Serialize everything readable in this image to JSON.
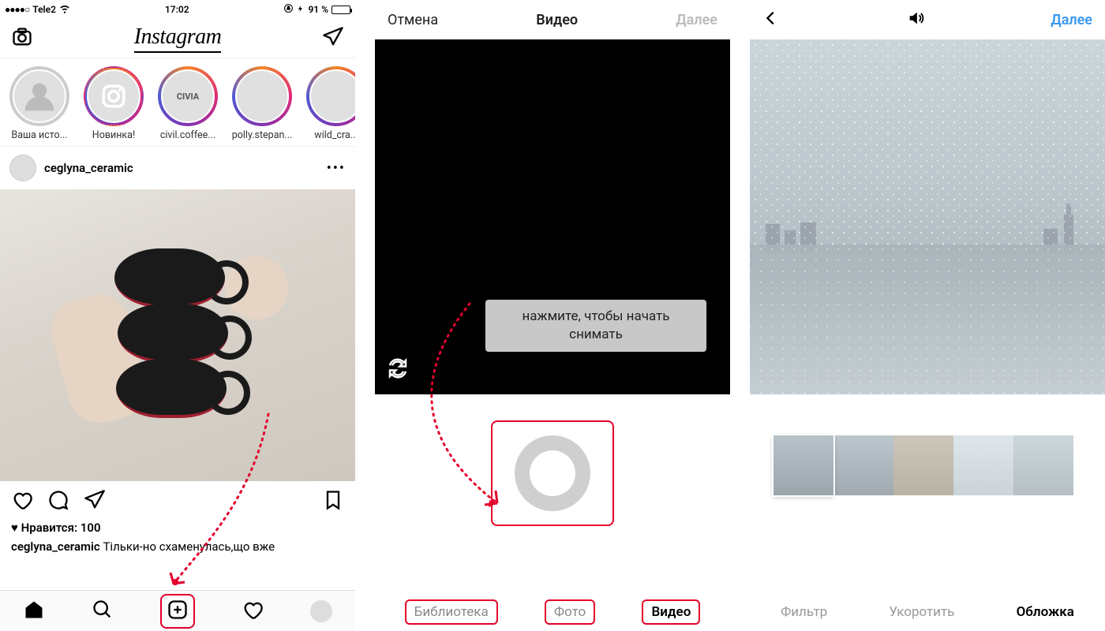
{
  "screen1": {
    "status": {
      "carrier": "Tele2",
      "time": "17:02",
      "battery_pct": "91 %"
    },
    "logo": "Instagram",
    "stories": [
      {
        "label": "Ваша исто...",
        "ring": "none",
        "variant": "empty"
      },
      {
        "label": "Новинка!",
        "ring": "dashed",
        "variant": "ig"
      },
      {
        "label": "civil.coffee...",
        "ring": "gradient",
        "variant": "civia",
        "text": "CIVIA"
      },
      {
        "label": "polly.stepan...",
        "ring": "gradient",
        "variant": "person"
      },
      {
        "label": "wild_cra...",
        "ring": "gradient",
        "variant": "photo"
      }
    ],
    "post": {
      "username": "ceglyna_ceramic",
      "likes_label": "Нравится: 100",
      "caption_user": "ceglyna_ceramic",
      "caption_text": "Тільки-но схаменулась,що вже"
    }
  },
  "screen2": {
    "nav": {
      "cancel": "Отмена",
      "title": "Видео",
      "next": "Далее"
    },
    "tooltip": "нажмите, чтобы начать снимать",
    "tabs": {
      "library": "Библиотека",
      "photo": "Фото",
      "video": "Видео"
    }
  },
  "screen3": {
    "nav": {
      "next": "Далее"
    },
    "tabs": {
      "filter": "Фильтр",
      "trim": "Укоротить",
      "cover": "Обложка"
    }
  },
  "colors": {
    "accent": "#3897f0",
    "highlight": "#e4002b"
  }
}
